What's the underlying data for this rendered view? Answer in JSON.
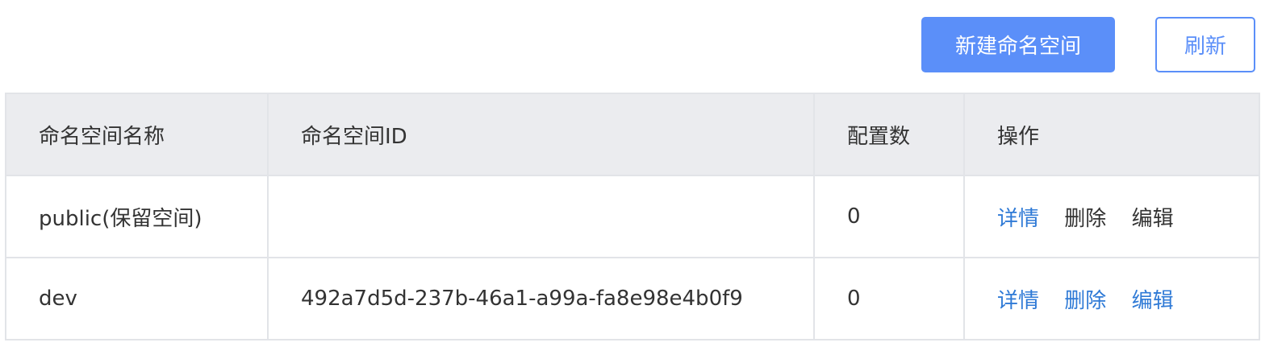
{
  "toolbar": {
    "create_label": "新建命名空间",
    "refresh_label": "刷新"
  },
  "table": {
    "headers": [
      "命名空间名称",
      "命名空间ID",
      "配置数",
      "操作"
    ],
    "rows": [
      {
        "name": "public(保留空间)",
        "id": "",
        "config_count": "0",
        "actions": [
          "详情",
          "删除",
          "编辑"
        ]
      },
      {
        "name": "dev",
        "id": "492a7d5d-237b-46a1-a99a-fa8e98e4b0f9",
        "config_count": "0",
        "actions": [
          "详情",
          "删除",
          "编辑"
        ]
      }
    ]
  },
  "colors": {
    "primary": "#5b8ff9",
    "link": "#2f7ad6",
    "header_bg": "#ebecef",
    "border": "#e2e4e8"
  }
}
